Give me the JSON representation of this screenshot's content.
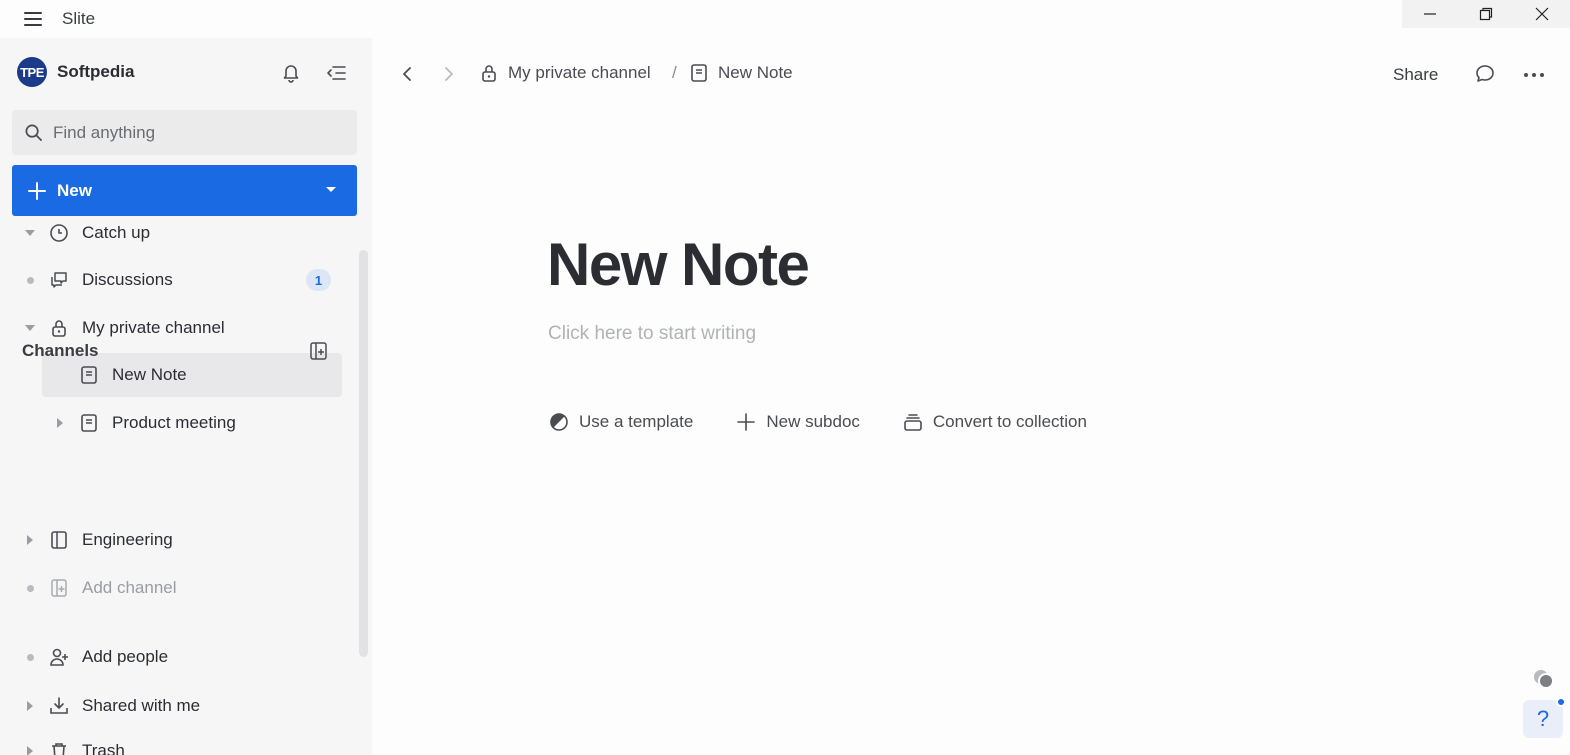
{
  "app": {
    "title": "Slite"
  },
  "colors": {
    "accent": "#1a6ae3",
    "sidebar_bg": "#f6f6f7",
    "badge_bg": "#dde6f7"
  },
  "workspace": {
    "logo_text": "TPE",
    "name": "Softpedia"
  },
  "search": {
    "placeholder": "Find anything"
  },
  "new_button": {
    "label": "New"
  },
  "sidebar": {
    "items": [
      {
        "label": "Catch up",
        "icon": "clock-icon"
      },
      {
        "label": "Discussions",
        "icon": "discussions-icon",
        "badge": "1"
      },
      {
        "label": "My private channel",
        "icon": "lock-icon",
        "expanded": true
      },
      {
        "label": "New Note",
        "icon": "doc-icon",
        "active": true
      },
      {
        "label": "Product meeting",
        "icon": "doc-icon"
      }
    ],
    "channels_title": "Channels",
    "channels": [
      {
        "label": "Engineering",
        "icon": "channel-icon"
      },
      {
        "label": "Add channel",
        "icon": "add-channel-icon"
      }
    ],
    "bottom": [
      {
        "label": "Add people",
        "icon": "add-person-icon"
      },
      {
        "label": "Shared with me",
        "icon": "inbox-download-icon"
      },
      {
        "label": "Trash",
        "icon": "trash-icon"
      }
    ]
  },
  "breadcrumb": {
    "channel": "My private channel",
    "separator": "/",
    "doc": "New Note"
  },
  "topbar": {
    "share_label": "Share"
  },
  "document": {
    "title": "New Note",
    "placeholder": "Click here to start writing",
    "actions": [
      {
        "label": "Use a template",
        "icon": "template-icon"
      },
      {
        "label": "New subdoc",
        "icon": "plus-icon"
      },
      {
        "label": "Convert to collection",
        "icon": "collection-icon"
      }
    ]
  },
  "help": {
    "label": "?"
  }
}
